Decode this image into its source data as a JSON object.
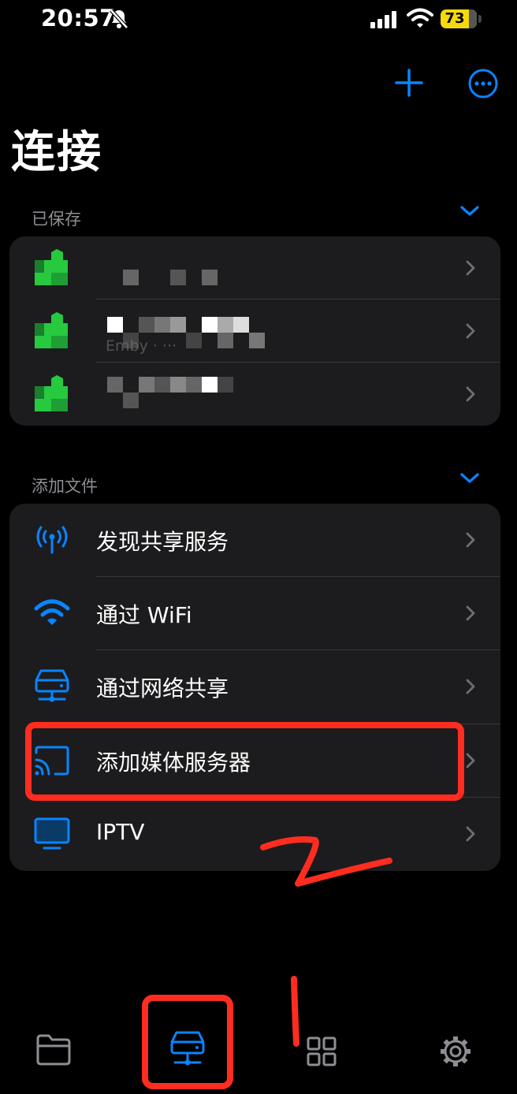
{
  "status_bar": {
    "time": "20:57",
    "battery": "73"
  },
  "page": {
    "title": "连接"
  },
  "sections": {
    "saved": {
      "header": "已保存",
      "servers": [
        {
          "name_fragment": "",
          "subtitle": ""
        },
        {
          "name_fragment": "",
          "subtitle": "Emby · ···"
        },
        {
          "name_fragment": "",
          "subtitle": ""
        }
      ]
    },
    "add_files": {
      "header": "添加文件",
      "options": [
        {
          "label": "发现共享服务",
          "icon": "antenna-icon"
        },
        {
          "label": "通过 WiFi",
          "icon": "wifi-icon"
        },
        {
          "label": "通过网络共享",
          "icon": "network-drive-icon"
        },
        {
          "label": "添加媒体服务器",
          "icon": "cast-screen-icon"
        },
        {
          "label": "IPTV",
          "icon": "tv-icon"
        }
      ]
    }
  },
  "tab_bar": {
    "tabs": [
      {
        "icon": "folder-icon",
        "active": false
      },
      {
        "icon": "network-drive-icon",
        "active": true
      },
      {
        "icon": "grid-icon",
        "active": false
      },
      {
        "icon": "gear-icon",
        "active": false
      }
    ]
  },
  "annotations": {
    "arrow_label": "2",
    "tab_label": "1"
  },
  "colors": {
    "accent": "#0a84ff",
    "annotation": "#ff2d20",
    "server_green": "#27c93f",
    "cell_bg": "#1c1c1e"
  }
}
